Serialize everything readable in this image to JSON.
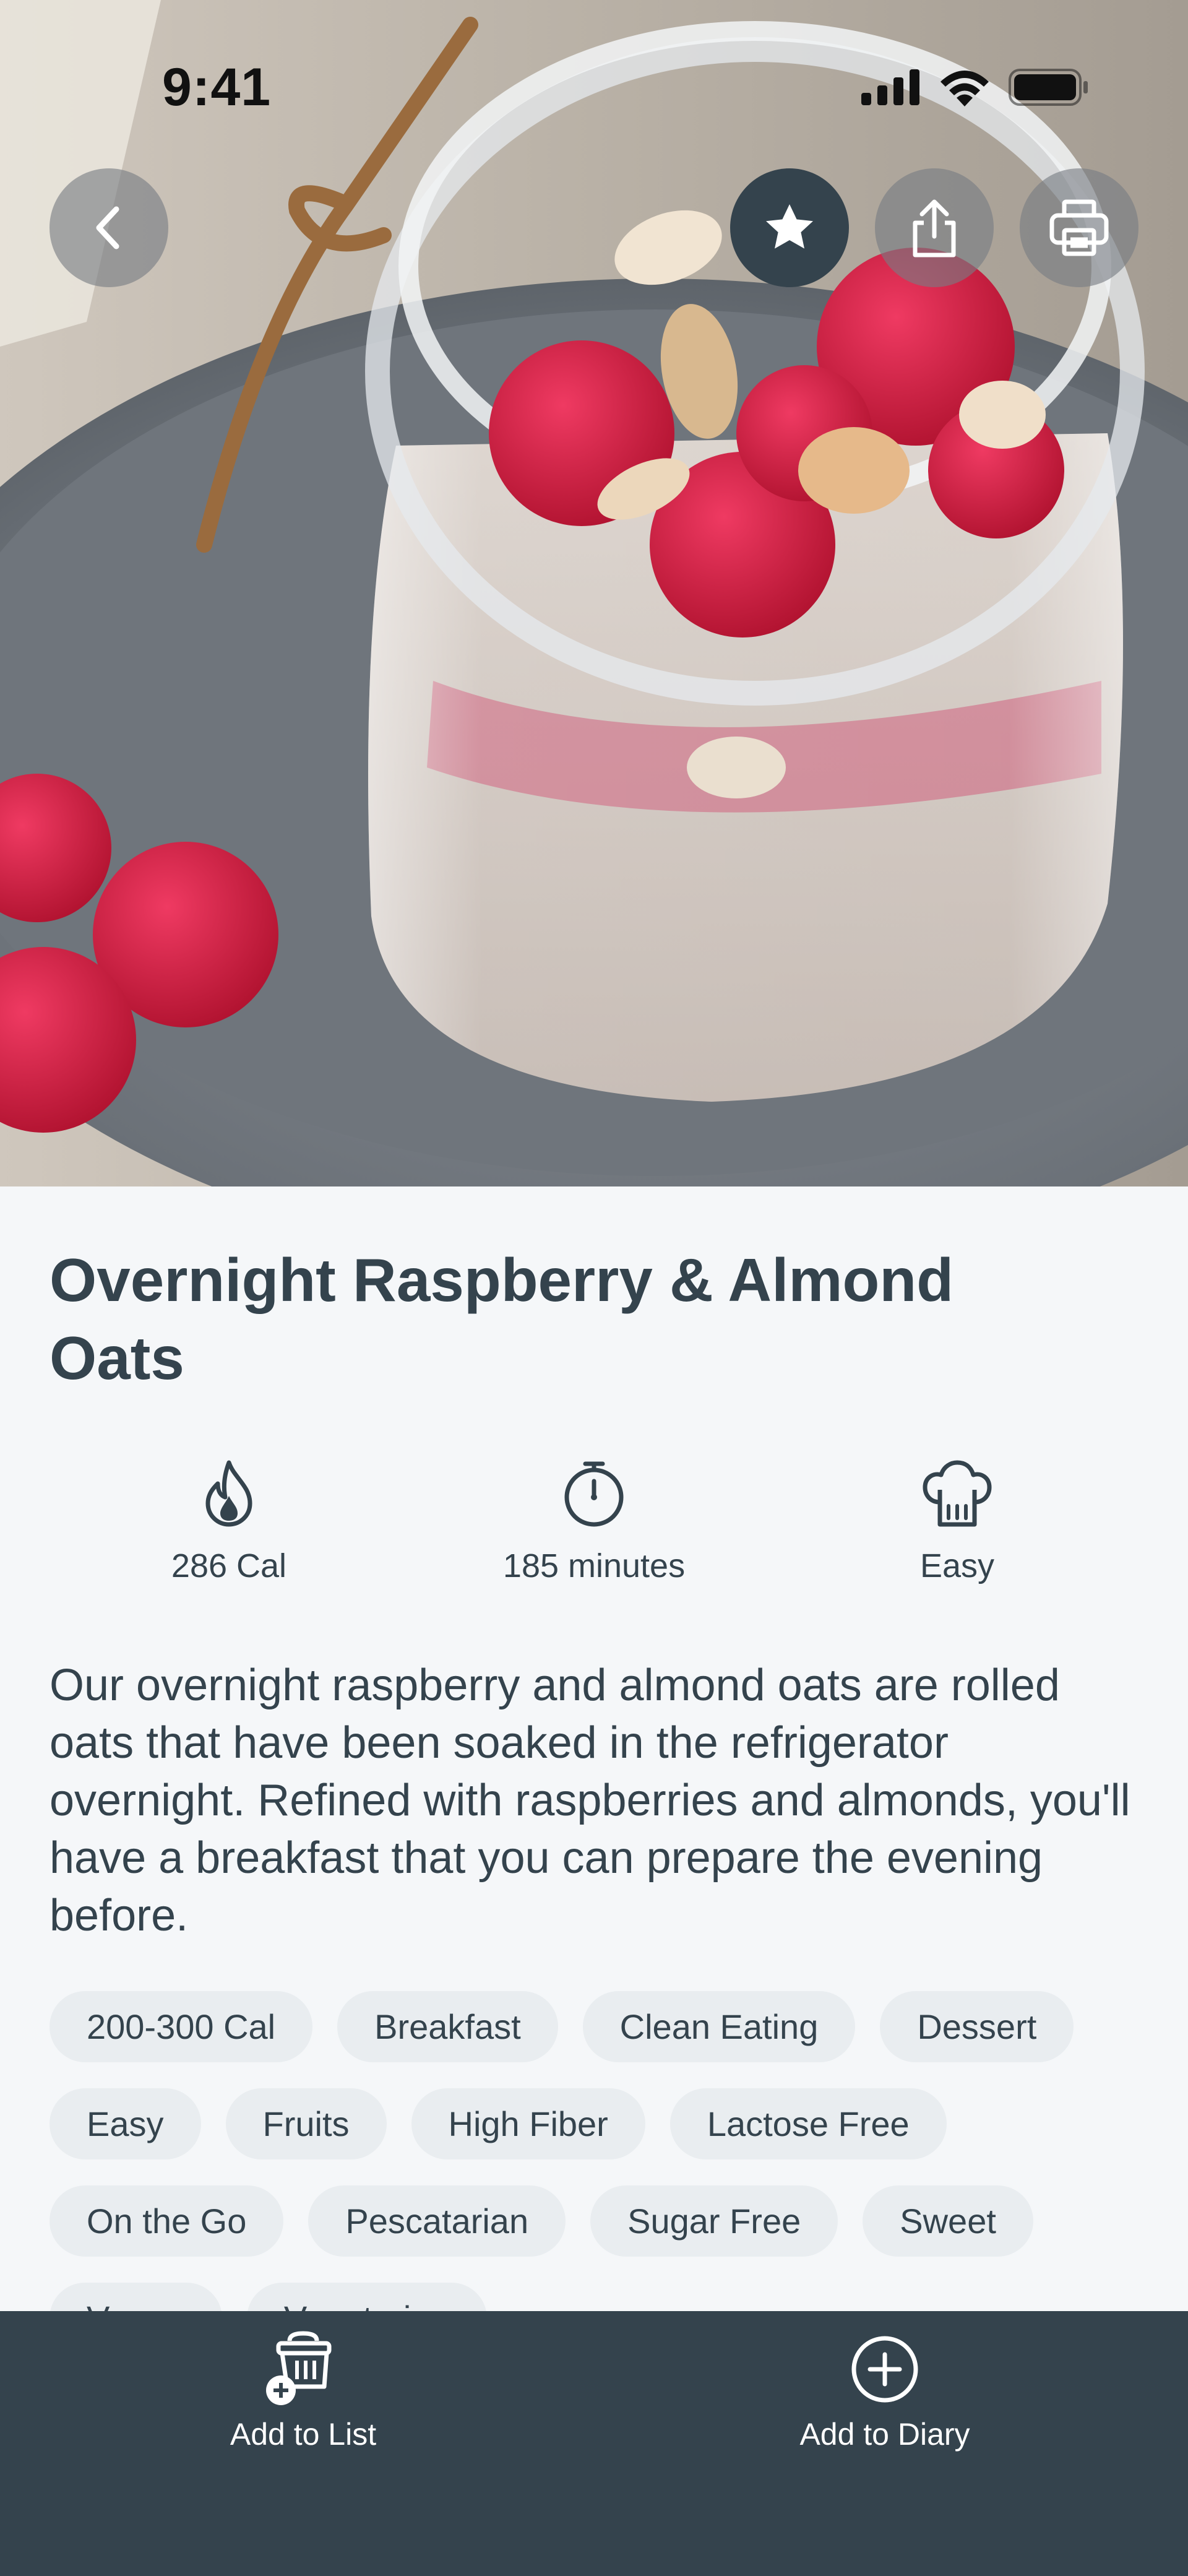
{
  "status_bar": {
    "time": "9:41"
  },
  "recipe": {
    "title": "Overnight Raspberry & Almond Oats",
    "stats": {
      "calories": "286 Cal",
      "time": "185 minutes",
      "difficulty": "Easy"
    },
    "description": "Our overnight raspberry and almond oats are rolled oats that have been soaked in the refrigerator overnight. Refined with raspberries and almonds, you'll have a breakfast that you can prepare the evening before.",
    "tags": [
      "200-300 Cal",
      "Breakfast",
      "Clean Eating",
      "Dessert",
      "Easy",
      "Fruits",
      "High Fiber",
      "Lactose Free",
      "On the Go",
      "Pescatarian",
      "Sugar Free",
      "Sweet",
      "Vegan",
      "Vegetarian"
    ]
  },
  "bottom_bar": {
    "add_to_list": "Add to List",
    "add_to_diary": "Add to Diary"
  },
  "icons": {
    "back": "chevron-left-icon",
    "favorite": "star-icon",
    "share": "share-icon",
    "print": "print-icon",
    "calories": "flame-icon",
    "time": "stopwatch-icon",
    "difficulty": "chef-hat-icon",
    "list": "basket-add-icon",
    "diary": "plus-circle-icon"
  },
  "colors": {
    "primary": "#34434d",
    "background": "#f5f7f9",
    "tag_background": "#e9edf0"
  }
}
